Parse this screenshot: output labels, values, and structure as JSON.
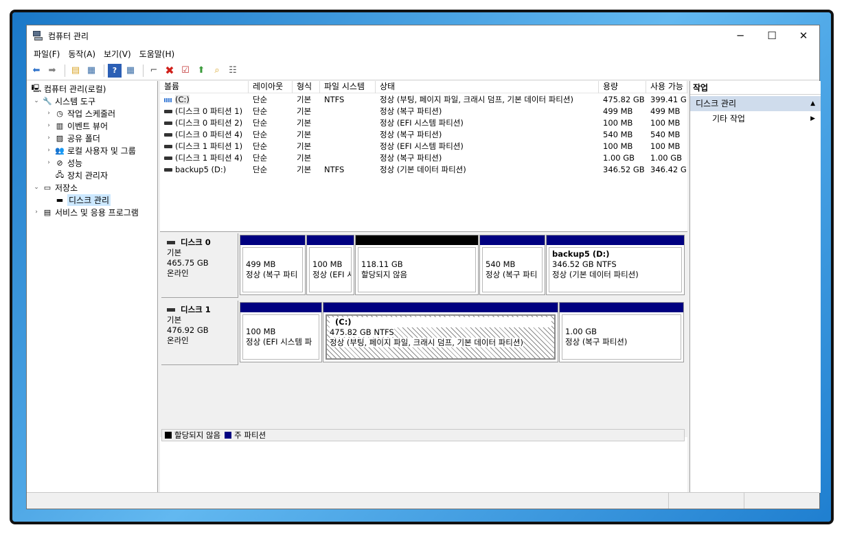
{
  "window": {
    "title": "컴퓨터 관리",
    "minimize": "─",
    "maximize": "☐",
    "close": "✕"
  },
  "menu": [
    "파일(F)",
    "동작(A)",
    "보기(V)",
    "도움말(H)"
  ],
  "tree": {
    "root": "컴퓨터 관리(로컬)",
    "items": [
      {
        "label": "시스템 도구",
        "level": 1,
        "arrow": "⌄",
        "icon": "tools-icon"
      },
      {
        "label": "작업 스케줄러",
        "level": 2,
        "arrow": "›",
        "icon": "clock-icon"
      },
      {
        "label": "이벤트 뷰어",
        "level": 2,
        "arrow": "›",
        "icon": "event-viewer-icon"
      },
      {
        "label": "공유 폴더",
        "level": 2,
        "arrow": "›",
        "icon": "shared-folder-icon"
      },
      {
        "label": "로컬 사용자 및 그룹",
        "level": 2,
        "arrow": "›",
        "icon": "users-icon"
      },
      {
        "label": "성능",
        "level": 2,
        "arrow": "›",
        "icon": "performance-icon"
      },
      {
        "label": "장치 관리자",
        "level": 2,
        "arrow": "",
        "icon": "device-manager-icon"
      },
      {
        "label": "저장소",
        "level": 1,
        "arrow": "⌄",
        "icon": "storage-icon"
      },
      {
        "label": "디스크 관리",
        "level": 2,
        "arrow": "",
        "icon": "disk-icon",
        "selected": true
      },
      {
        "label": "서비스 및 응용 프로그램",
        "level": 1,
        "arrow": "›",
        "icon": "services-icon"
      }
    ]
  },
  "list": {
    "columns": [
      "볼륨",
      "레이아웃",
      "형식",
      "파일 시스템",
      "상태",
      "용량",
      "사용 가능"
    ],
    "rows": [
      [
        "(C:)",
        "단순",
        "기본",
        "NTFS",
        "정상 (부팅, 페이지 파일, 크래시 덤프, 기본 데이터 파티션)",
        "475.82 GB",
        "399.41 G"
      ],
      [
        "(디스크 0 파티션 1)",
        "단순",
        "기본",
        "",
        "정상 (복구 파티션)",
        "499 MB",
        "499 MB"
      ],
      [
        "(디스크 0 파티션 2)",
        "단순",
        "기본",
        "",
        "정상 (EFI 시스템 파티션)",
        "100 MB",
        "100 MB"
      ],
      [
        "(디스크 0 파티션 4)",
        "단순",
        "기본",
        "",
        "정상 (복구 파티션)",
        "540 MB",
        "540 MB"
      ],
      [
        "(디스크 1 파티션 1)",
        "단순",
        "기본",
        "",
        "정상 (EFI 시스템 파티션)",
        "100 MB",
        "100 MB"
      ],
      [
        "(디스크 1 파티션 4)",
        "단순",
        "기본",
        "",
        "정상 (복구 파티션)",
        "1.00 GB",
        "1.00 GB"
      ],
      [
        "backup5 (D:)",
        "단순",
        "기본",
        "NTFS",
        "정상 (기본 데이터 파티션)",
        "346.52 GB",
        "346.42 G"
      ]
    ]
  },
  "scroll": {
    "left": "‹",
    "right": "›"
  },
  "disks": [
    {
      "name": "디스크 0",
      "type": "기본",
      "size": "465.75 GB",
      "status": "온라인",
      "partitions": [
        {
          "title": "",
          "line1": "499 MB",
          "line2": "정상 (복구 파티",
          "bar": "navy"
        },
        {
          "title": "",
          "line1": "100 MB",
          "line2": "정상 (EFI 시",
          "bar": "navy"
        },
        {
          "title": "",
          "line1": "118.11 GB",
          "line2": "할당되지 않음",
          "bar": "black"
        },
        {
          "title": "",
          "line1": "540 MB",
          "line2": "정상 (복구 파티",
          "bar": "navy"
        },
        {
          "title": "backup5  (D:)",
          "line1": "346.52 GB NTFS",
          "line2": "정상 (기본 데이터 파티션)",
          "bar": "navy"
        }
      ]
    },
    {
      "name": "디스크 1",
      "type": "기본",
      "size": "476.92 GB",
      "status": "온라인",
      "partitions": [
        {
          "title": "",
          "line1": "100 MB",
          "line2": "정상 (EFI 시스템 파",
          "bar": "navy"
        },
        {
          "title": "(C:)",
          "line1": "475.82 GB NTFS",
          "line2": "정상 (부팅, 페이지 파일, 크래시 덤프, 기본 데이터 파티션)",
          "bar": "navy",
          "hatched": true
        },
        {
          "title": "",
          "line1": "1.00 GB",
          "line2": "정상 (복구 파티션)",
          "bar": "navy"
        }
      ]
    }
  ],
  "legend": {
    "unallocated": "할당되지 않음",
    "primary": "주 파티션",
    "unallocated_color": "#000000",
    "primary_color": "#000080"
  },
  "actions": {
    "header": "작업",
    "section": "디스크 관리",
    "section_arrow": "▲",
    "item": "기타 작업",
    "item_arrow": "▶"
  }
}
